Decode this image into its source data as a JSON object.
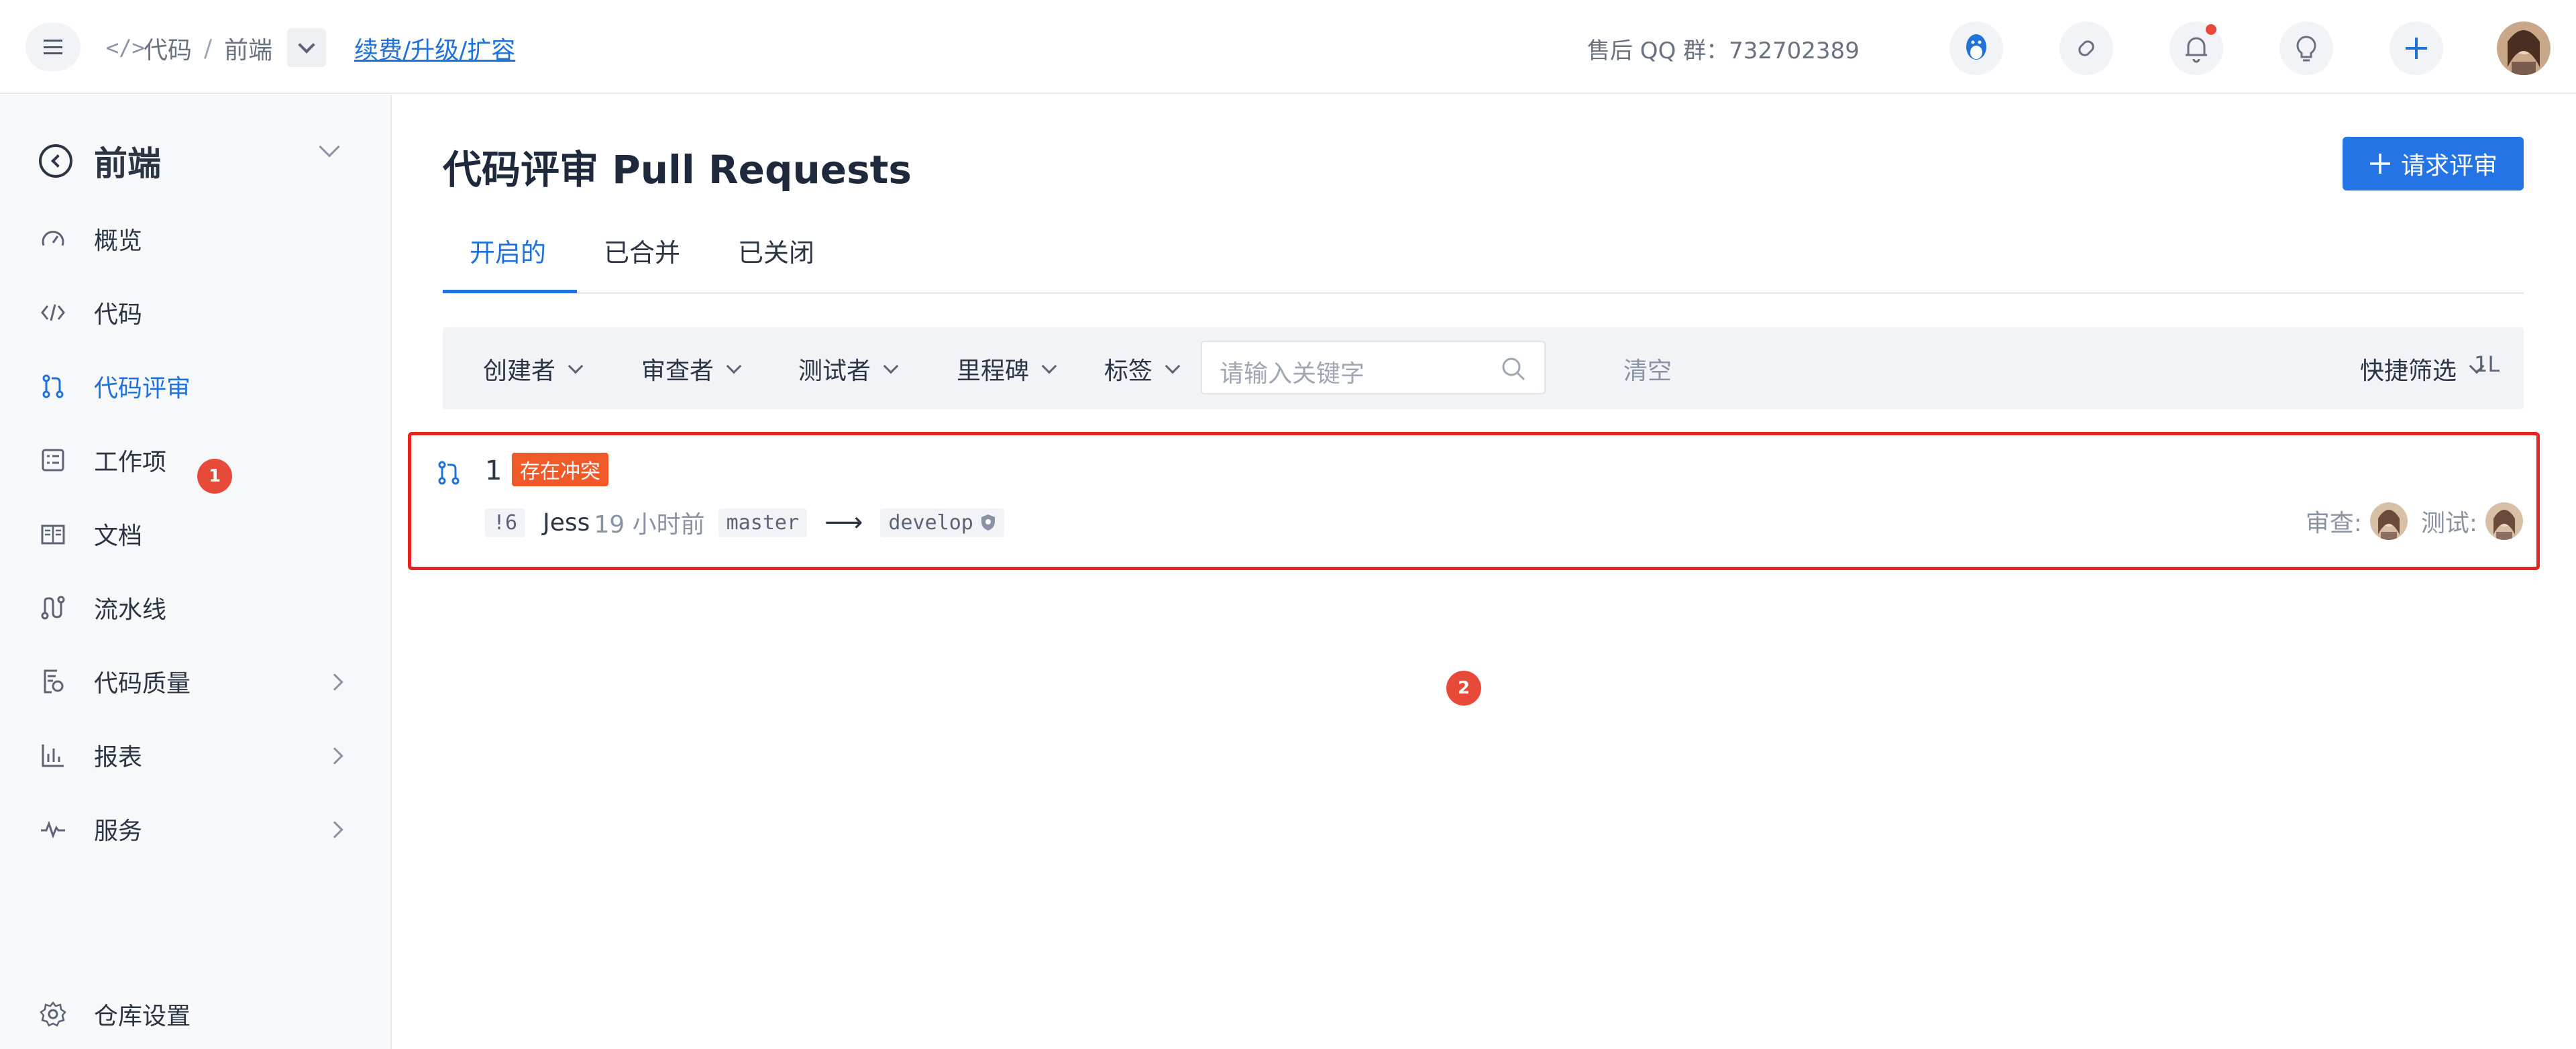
{
  "topbar": {
    "breadcrumb": [
      "代码",
      "/",
      "前端"
    ],
    "renew_link": "续费/升级/扩容",
    "qq_group": "售后 QQ 群：732702389"
  },
  "sidebar": {
    "repo_name": "前端",
    "items": [
      {
        "label": "概览",
        "icon": "dashboard-icon"
      },
      {
        "label": "代码",
        "icon": "code-icon"
      },
      {
        "label": "代码评审",
        "icon": "pull-request-icon",
        "active": true,
        "badge": "1"
      },
      {
        "label": "工作项",
        "icon": "work-item-icon"
      },
      {
        "label": "文档",
        "icon": "book-icon"
      },
      {
        "label": "流水线",
        "icon": "pipeline-icon"
      },
      {
        "label": "代码质量",
        "icon": "quality-icon",
        "expandable": true
      },
      {
        "label": "报表",
        "icon": "bar-chart-icon",
        "expandable": true
      },
      {
        "label": "服务",
        "icon": "pulse-icon",
        "expandable": true
      }
    ],
    "settings_label": "仓库设置"
  },
  "main": {
    "title": "代码评审 Pull Requests",
    "request_button": "请求评审",
    "tabs": [
      "开启的",
      "已合并",
      "已关闭"
    ],
    "active_tab": 0,
    "filters": [
      "创建者",
      "审查者",
      "测试者",
      "里程碑",
      "标签"
    ],
    "search_placeholder": "请输入关键字",
    "clear_label": "清空",
    "quick_filter": "快捷筛选",
    "sort_icon_text": "1L",
    "pull_requests": [
      {
        "number": "1",
        "conflict_label": "存在冲突",
        "iid": "!6",
        "author": "Jess",
        "time": "19 小时前",
        "source_branch": "master",
        "target_branch": "develop",
        "reviewer_label": "审查:",
        "tester_label": "测试:"
      }
    ],
    "annotation_badge": "2"
  },
  "colors": {
    "accent": "#1f72d9",
    "primary_button": "#2474e5",
    "conflict": "#f05a28",
    "highlight_border": "#e8231f",
    "badge": "#e84a3a"
  }
}
